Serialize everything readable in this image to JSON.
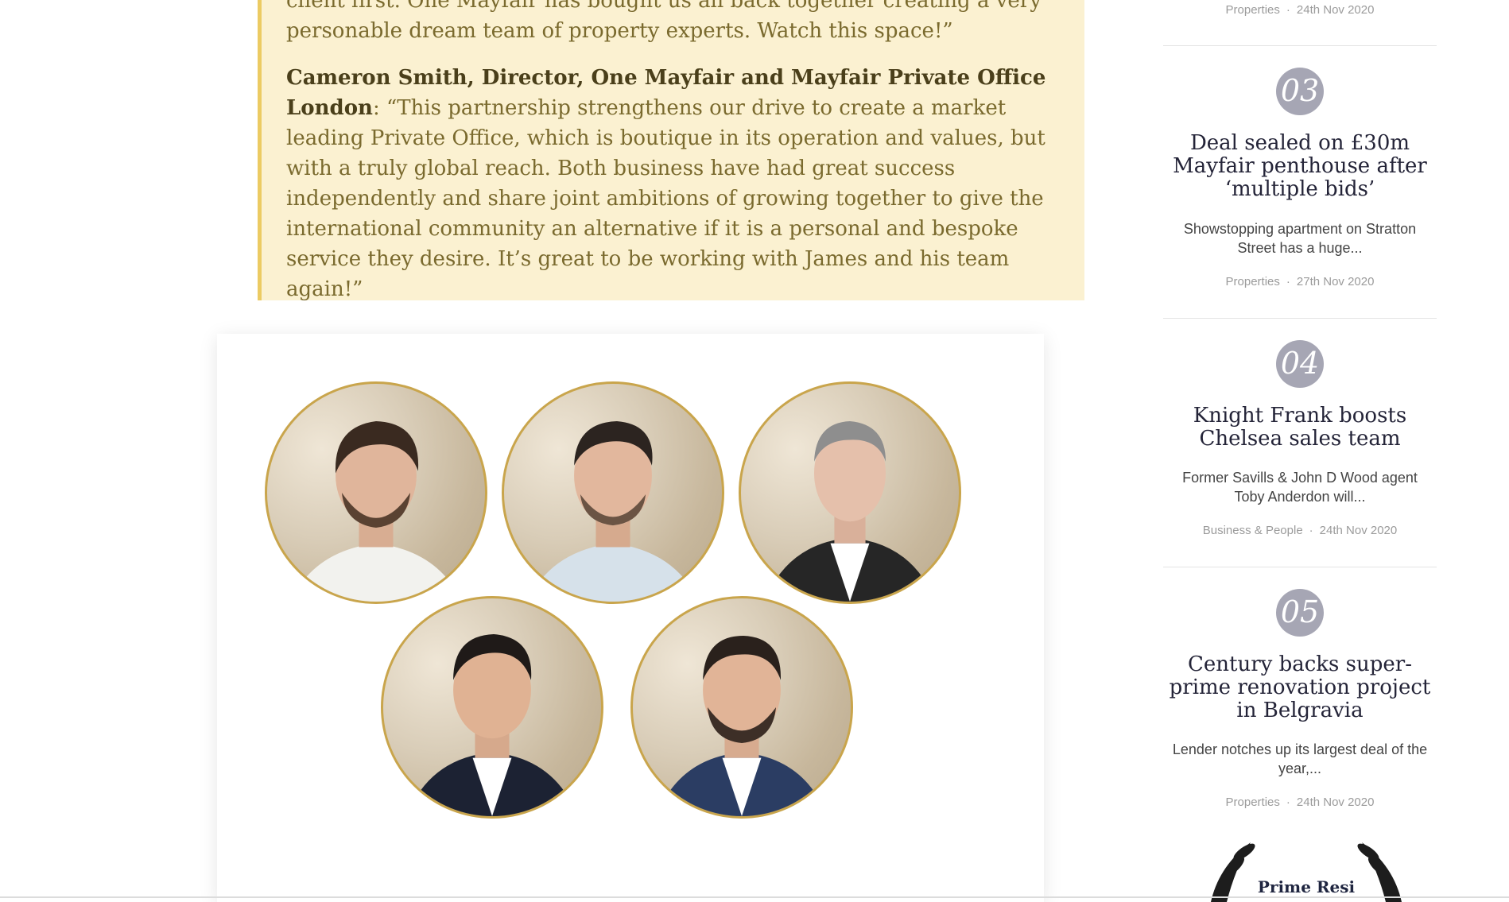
{
  "quote": {
    "para1": "client first. One Mayfair has bought us all back together creating a very personable dream team of property experts. Watch this space!”",
    "speaker": "Cameron Smith, Director, One Mayfair and Mayfair Private Office London",
    "para2": ": “This partnership strengthens our drive to create a market leading Private Office, which is boutique in its operation and values, but with a truly global reach. Both business have had great success independently and share joint ambitions of growing together to give the international community an alternative if it is a personal and bespoke service they desire. It’s great to be working with James and his team again!”",
    "accent_color": "#eccb63",
    "background_color": "#fbf1d1"
  },
  "team_photo": {
    "frame_color": "#c9a54c",
    "portraits": [
      {
        "attire": "white-shirt"
      },
      {
        "attire": "light-blue-shirt"
      },
      {
        "attire": "dark-suit"
      },
      {
        "attire": "navy-suit"
      },
      {
        "attire": "blue-suit"
      }
    ]
  },
  "sidebar": {
    "top_meta": {
      "category": "Properties",
      "separator": "·",
      "date": "24th Nov 2020"
    },
    "items": [
      {
        "number": "03",
        "title": "Deal sealed on £30m Mayfair penthouse after ‘multiple bids’",
        "excerpt": "Showstopping apartment on Stratton Street has a huge...",
        "category": "Properties",
        "separator": "·",
        "date": "27th Nov 2020"
      },
      {
        "number": "04",
        "title": "Knight Frank boosts Chelsea sales team",
        "excerpt": "Former Savills & John D Wood agent Toby Anderdon will...",
        "category": "Business & People",
        "separator": "·",
        "date": "24th Nov 2020"
      },
      {
        "number": "05",
        "title": "Century backs super-prime renovation project in Belgravia",
        "excerpt": "Lender notches up its largest deal of the year,...",
        "category": "Properties",
        "separator": "·",
        "date": "24th Nov 2020"
      }
    ],
    "logo": {
      "text": "Prime Resi",
      "icon": "laurel-wreath-icon"
    }
  }
}
